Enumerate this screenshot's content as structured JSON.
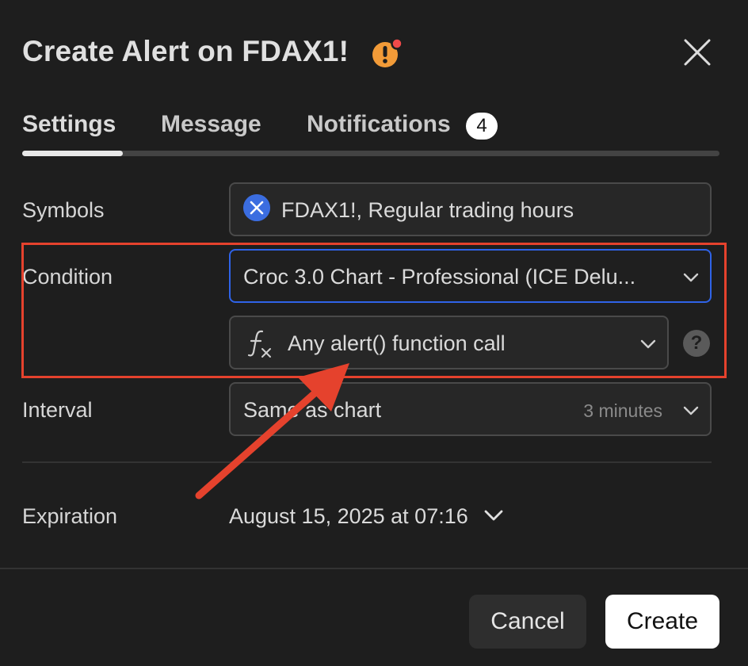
{
  "dialog": {
    "title": "Create Alert on FDAX1!",
    "warning_icon": "warning-icon",
    "close_icon": "close-icon"
  },
  "tabs": [
    {
      "label": "Settings",
      "active": true
    },
    {
      "label": "Message",
      "active": false
    },
    {
      "label": "Notifications",
      "active": false,
      "badge": "4"
    }
  ],
  "form": {
    "symbols": {
      "label": "Symbols",
      "value": "FDAX1!, Regular trading hours"
    },
    "condition": {
      "label": "Condition",
      "indicator": "Croc 3.0 Chart - Professional (ICE Delu...",
      "trigger": "Any alert() function call",
      "help": "?"
    },
    "interval": {
      "label": "Interval",
      "value": "Same as chart",
      "hint": "3 minutes"
    },
    "expiration": {
      "label": "Expiration",
      "value": "August 15, 2025 at 07:16"
    }
  },
  "buttons": {
    "cancel": "Cancel",
    "create": "Create"
  },
  "colors": {
    "background": "#1e1e1e",
    "focus_border": "#2f63e8",
    "highlight": "#e5422d",
    "warning": "#f29b38",
    "symbol_icon": "#3b6de0"
  }
}
